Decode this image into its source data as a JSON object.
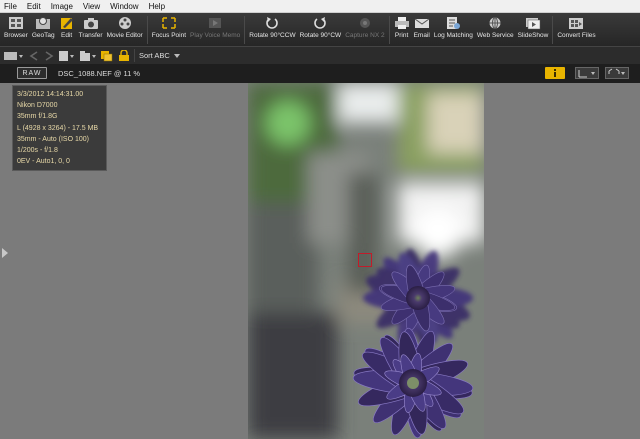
{
  "menu": [
    "File",
    "Edit",
    "Image",
    "View",
    "Window",
    "Help"
  ],
  "toolbar": [
    {
      "label": "Browser",
      "icon": "browser-icon",
      "enabled": true
    },
    {
      "label": "GeoTag",
      "icon": "geotag-icon",
      "enabled": true
    },
    {
      "label": "Edit",
      "icon": "edit-icon",
      "enabled": true
    },
    {
      "label": "Transfer",
      "icon": "transfer-icon",
      "enabled": true
    },
    {
      "label": "Movie Editor",
      "icon": "movie-editor-icon",
      "enabled": true
    },
    {
      "label": "Focus Point",
      "icon": "focus-point-icon",
      "enabled": true
    },
    {
      "label": "Play Voice Memo",
      "icon": "play-voice-memo-icon",
      "enabled": false
    },
    {
      "label": "Rotate 90°CCW",
      "icon": "rotate-ccw-icon",
      "enabled": true
    },
    {
      "label": "Rotate 90°CW",
      "icon": "rotate-cw-icon",
      "enabled": true
    },
    {
      "label": "Capture NX 2",
      "icon": "capture-nx2-icon",
      "enabled": false
    },
    {
      "label": "Print",
      "icon": "print-icon",
      "enabled": true
    },
    {
      "label": "Email",
      "icon": "email-icon",
      "enabled": true
    },
    {
      "label": "Log Matching",
      "icon": "log-matching-icon",
      "enabled": true
    },
    {
      "label": "Web Service",
      "icon": "web-service-icon",
      "enabled": true
    },
    {
      "label": "SlideShow",
      "icon": "slideshow-icon",
      "enabled": true
    },
    {
      "label": "Convert Files",
      "icon": "convert-files-icon",
      "enabled": true
    }
  ],
  "toolbar2": {
    "sort_label": "Sort ABC"
  },
  "infobar": {
    "raw_badge": "RAW",
    "filename": "DSC_1088.NEF @ 11 %"
  },
  "overlay": [
    "3/3/2012 14:14:31.00",
    "Nikon D7000",
    "35mm f/1.8G",
    "L (4928 x 3264) - 17.5 MB",
    "35mm - Auto (ISO 100)",
    "1/200s - f/1.8",
    "0EV - Auto1, 0, 0"
  ],
  "colors": {
    "accent_yellow": "#e8b400",
    "focus_box": "#c21b2a",
    "overlay_text": "#e8d9a8"
  }
}
